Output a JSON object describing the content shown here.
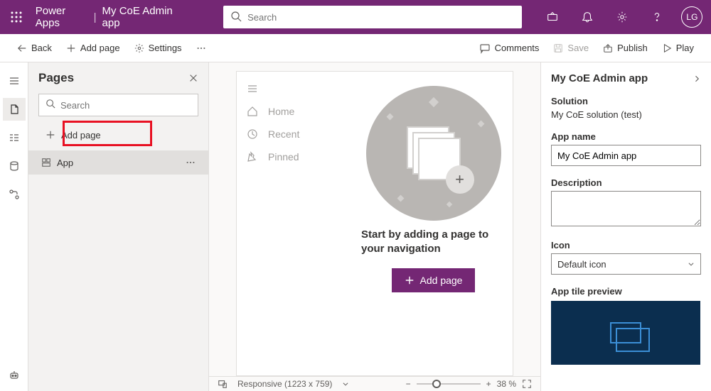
{
  "header": {
    "product": "Power Apps",
    "app_title": "My CoE Admin app",
    "search_placeholder": "Search",
    "avatar_initials": "LG"
  },
  "cmdbar": {
    "back": "Back",
    "add_page": "Add page",
    "settings": "Settings",
    "comments": "Comments",
    "save": "Save",
    "publish": "Publish",
    "play": "Play"
  },
  "pages": {
    "title": "Pages",
    "search_placeholder": "Search",
    "add_page": "Add page",
    "tree_root": "App"
  },
  "preview": {
    "nav_items": [
      "Home",
      "Recent",
      "Pinned"
    ],
    "empty_msg": "Start by adding a page to your navigation",
    "add_page_btn": "Add page"
  },
  "status": {
    "mode": "Responsive (1223 x 759)",
    "zoom": "38 %"
  },
  "props": {
    "title": "My CoE Admin app",
    "solution_label": "Solution",
    "solution_value": "My CoE solution (test)",
    "appname_label": "App name",
    "appname_value": "My CoE Admin app",
    "description_label": "Description",
    "description_value": "",
    "icon_label": "Icon",
    "icon_value": "Default icon",
    "tile_label": "App tile preview"
  }
}
